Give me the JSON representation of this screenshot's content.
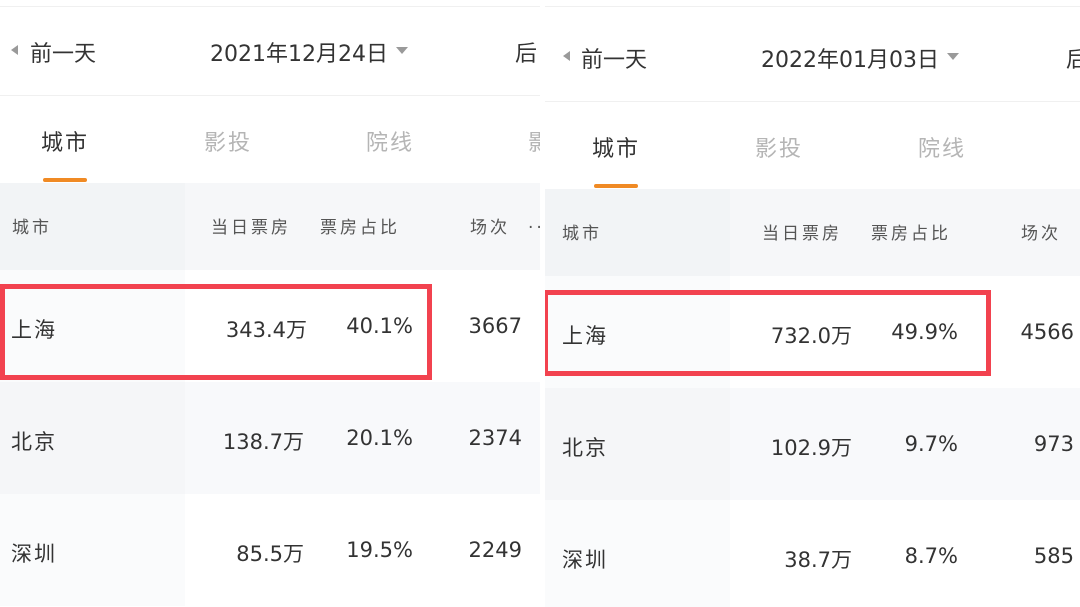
{
  "panels": [
    {
      "nav": {
        "prev_label": "前一天",
        "date": "2021年12月24日",
        "next_label": "后"
      },
      "tabs": [
        {
          "label": "城市",
          "active": true
        },
        {
          "label": "影投",
          "active": false
        },
        {
          "label": "院线",
          "active": false
        },
        {
          "label": "影",
          "active": false
        }
      ],
      "columns": [
        "城市",
        "当日票房",
        "票房占比",
        "场次",
        "..."
      ],
      "rows": [
        {
          "city": "上海",
          "box_office": "343.4万",
          "share": "40.1%",
          "shows": "3667",
          "highlighted": true
        },
        {
          "city": "北京",
          "box_office": "138.7万",
          "share": "20.1%",
          "shows": "2374",
          "highlighted": false
        },
        {
          "city": "深圳",
          "box_office": "85.5万",
          "share": "19.5%",
          "shows": "2249",
          "highlighted": false
        }
      ]
    },
    {
      "nav": {
        "prev_label": "前一天",
        "date": "2022年01月03日",
        "next_label": "后"
      },
      "tabs": [
        {
          "label": "城市",
          "active": true
        },
        {
          "label": "影投",
          "active": false
        },
        {
          "label": "院线",
          "active": false
        }
      ],
      "columns": [
        "城市",
        "当日票房",
        "票房占比",
        "场次"
      ],
      "rows": [
        {
          "city": "上海",
          "box_office": "732.0万",
          "share": "49.9%",
          "shows": "4566",
          "highlighted": true
        },
        {
          "city": "北京",
          "box_office": "102.9万",
          "share": "9.7%",
          "shows": "973",
          "highlighted": false
        },
        {
          "city": "深圳",
          "box_office": "38.7万",
          "share": "8.7%",
          "shows": "585",
          "highlighted": false
        }
      ]
    }
  ],
  "colors": {
    "highlight_border": "#f2424f",
    "tab_underline": "#f08a24",
    "inactive_tab": "#b5b5b5",
    "header_bg": "#f6f7f9"
  }
}
